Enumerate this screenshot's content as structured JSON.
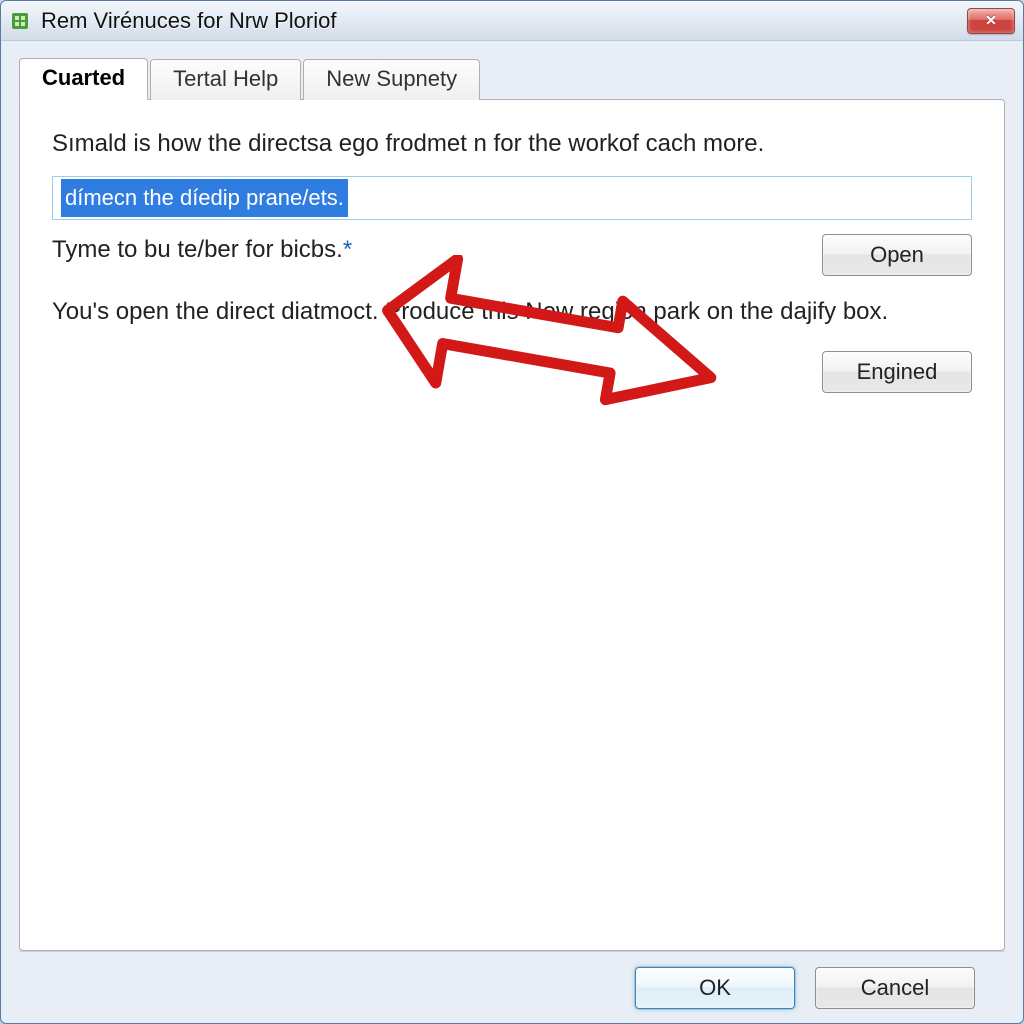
{
  "window": {
    "title": "Rem Virénuces for Nrw Ploriof"
  },
  "tabs": [
    {
      "label": "Cuarted",
      "active": true
    },
    {
      "label": "Tertal Help",
      "active": false
    },
    {
      "label": "New Supnety",
      "active": false
    }
  ],
  "content": {
    "intro": "Sımald is how the directsa ego frodmet n  for the workof cach more.",
    "input_value": "dímecn the díedip prane/ets.",
    "hint": "Tyme to bu te/ber for bicbs.",
    "hint_star": "*",
    "lower": "You's open the direct diatmoct. Produce this New region park on the dajify box."
  },
  "buttons": {
    "open": "Open",
    "engined": "Engined",
    "ok": "OK",
    "cancel": "Cancel"
  }
}
